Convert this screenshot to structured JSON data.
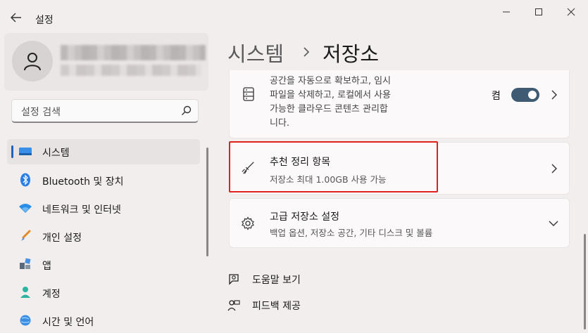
{
  "window": {
    "title": "설정"
  },
  "profile": {},
  "search": {
    "placeholder": "설정 검색"
  },
  "nav": [
    {
      "label": "시스템",
      "icon": "monitor-icon"
    },
    {
      "label": "Bluetooth 및 장치",
      "icon": "bluetooth-icon"
    },
    {
      "label": "네트워크 및 인터넷",
      "icon": "wifi-icon"
    },
    {
      "label": "개인 설정",
      "icon": "brush-icon"
    },
    {
      "label": "앱",
      "icon": "apps-icon"
    },
    {
      "label": "계정",
      "icon": "person-icon"
    },
    {
      "label": "시간 및 언어",
      "icon": "globe-icon"
    }
  ],
  "breadcrumb": {
    "parent": "시스템",
    "current": "저장소"
  },
  "cards": {
    "storage_sense": {
      "desc_lines": [
        "공간을 자동으로 확보하고, 임시",
        "파일을 삭제하고, 로컬에서 사용",
        "가능한 클라우드 콘텐츠 관리합",
        "니다."
      ],
      "toggle_label": "켬",
      "toggle_on": true
    },
    "cleanup": {
      "title": "추천 정리 항목",
      "subtitle": "저장소 최대 1.00GB 사용 가능"
    },
    "advanced": {
      "title": "고급 저장소 설정",
      "subtitle": "백업 옵션, 저장소 공간, 기타 디스크 및 볼륨"
    }
  },
  "links": {
    "help": "도움말 보기",
    "feedback": "피드백 제공"
  },
  "colors": {
    "accent": "#1e64c8",
    "toggle_on": "#3f5b74",
    "highlight": "#e0201c"
  }
}
